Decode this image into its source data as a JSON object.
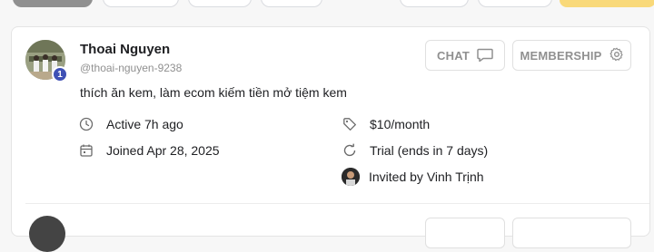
{
  "profile": {
    "name": "Thoai Nguyen",
    "handle": "@thoai-nguyen-9238",
    "level": "1",
    "bio": "thích ăn kem, làm ecom kiếm tiền mở tiệm kem",
    "active": "Active 7h ago",
    "joined": "Joined Apr 28, 2025",
    "price": "$10/month",
    "trial": "Trial (ends in 7 days)",
    "invited": "Invited by Vinh Trịnh"
  },
  "actions": {
    "chat_label": "CHAT",
    "membership_label": "MEMBERSHIP"
  },
  "icons": {
    "chat": "chat-bubble-icon",
    "membership": "gear-icon",
    "active": "clock-icon",
    "joined": "calendar-icon",
    "price": "tag-icon",
    "trial": "refresh-icon"
  },
  "colors": {
    "level_badge": "#3f51b5",
    "accent_yellow": "#f9d97a"
  }
}
